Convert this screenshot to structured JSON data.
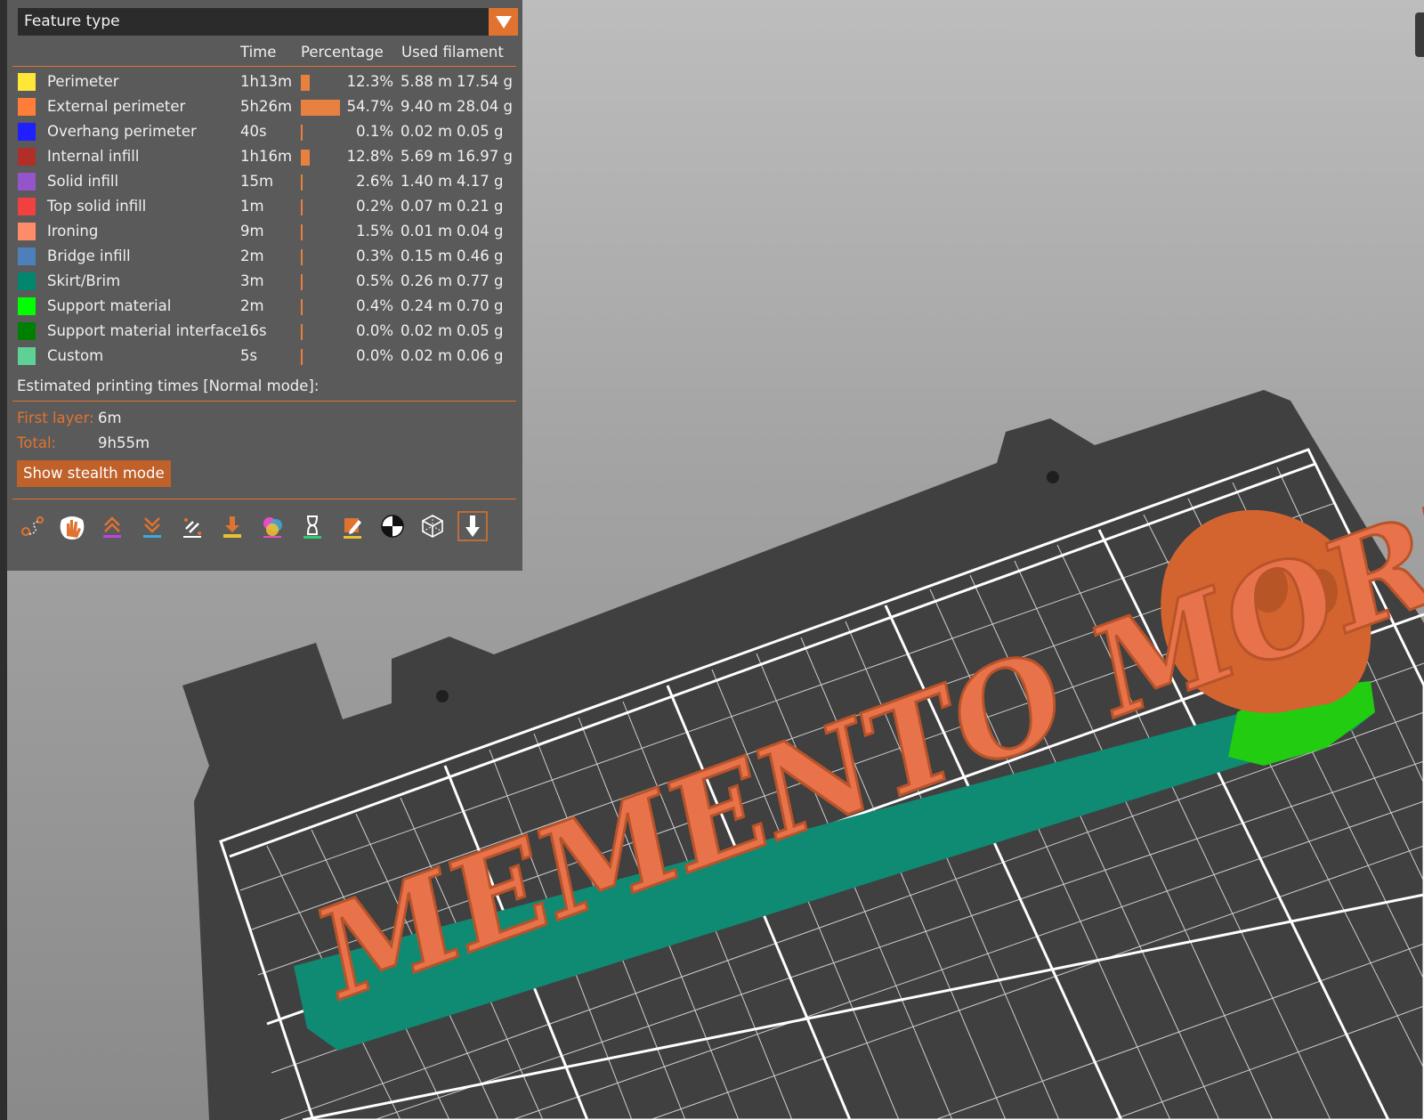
{
  "legend": {
    "dropdown_label": "Feature type",
    "headers": {
      "time": "Time",
      "percentage": "Percentage",
      "used_filament": "Used filament"
    },
    "rows": [
      {
        "name": "Perimeter",
        "color": "#ffe637",
        "time": "1h13m",
        "pct_value": 12.3,
        "percentage": "12.3%",
        "length": "5.88 m",
        "weight": "17.54 g"
      },
      {
        "name": "External perimeter",
        "color": "#ff7d38",
        "time": "5h26m",
        "pct_value": 54.7,
        "percentage": "54.7%",
        "length": "9.40 m",
        "weight": "28.04 g"
      },
      {
        "name": "Overhang perimeter",
        "color": "#1f1fff",
        "time": "40s",
        "pct_value": 0.1,
        "percentage": "0.1%",
        "length": "0.02 m",
        "weight": "0.05 g"
      },
      {
        "name": "Internal infill",
        "color": "#b03029",
        "time": "1h16m",
        "pct_value": 12.8,
        "percentage": "12.8%",
        "length": "5.69 m",
        "weight": "16.97 g"
      },
      {
        "name": "Solid infill",
        "color": "#9654cc",
        "time": "15m",
        "pct_value": 2.6,
        "percentage": "2.6%",
        "length": "1.40 m",
        "weight": "4.17 g"
      },
      {
        "name": "Top solid infill",
        "color": "#f04040",
        "time": "1m",
        "pct_value": 0.2,
        "percentage": "0.2%",
        "length": "0.07 m",
        "weight": "0.21 g"
      },
      {
        "name": "Ironing",
        "color": "#ff8c69",
        "time": "9m",
        "pct_value": 1.5,
        "percentage": "1.5%",
        "length": "0.01 m",
        "weight": "0.04 g"
      },
      {
        "name": "Bridge infill",
        "color": "#4d80ba",
        "time": "2m",
        "pct_value": 0.3,
        "percentage": "0.3%",
        "length": "0.15 m",
        "weight": "0.46 g"
      },
      {
        "name": "Skirt/Brim",
        "color": "#00876e",
        "time": "3m",
        "pct_value": 0.5,
        "percentage": "0.5%",
        "length": "0.26 m",
        "weight": "0.77 g"
      },
      {
        "name": "Support material",
        "color": "#00ff00",
        "time": "2m",
        "pct_value": 0.4,
        "percentage": "0.4%",
        "length": "0.24 m",
        "weight": "0.70 g"
      },
      {
        "name": "Support material interface",
        "color": "#008000",
        "time": "16s",
        "pct_value": 0.0,
        "percentage": "0.0%",
        "length": "0.02 m",
        "weight": "0.05 g"
      },
      {
        "name": "Custom",
        "color": "#5ed194",
        "time": "5s",
        "pct_value": 0.0,
        "percentage": "0.0%",
        "length": "0.02 m",
        "weight": "0.06 g"
      }
    ],
    "estimated_label": "Estimated printing times [Normal mode]:",
    "first_layer_label": "First layer:",
    "first_layer_value": "6m",
    "total_label": "Total:",
    "total_value": "9h55m",
    "stealth_button": "Show stealth mode",
    "toolbar_icons": [
      "travel-icon",
      "seams-icon",
      "retractions-icon",
      "deretractions-icon",
      "wipe-icon",
      "tool-changes-icon",
      "color-changes-icon",
      "pause-icon",
      "custom-gcode-icon",
      "center-of-gravity-icon",
      "shells-icon",
      "tool-marker-icon"
    ]
  },
  "viewport": {
    "model_text": "MEMENTO MORI",
    "colors": {
      "bed": "#3f3f3f",
      "grid": "#ffffff",
      "model": "#e8734a",
      "brim": "#0f8a73",
      "support": "#22cc11"
    }
  }
}
